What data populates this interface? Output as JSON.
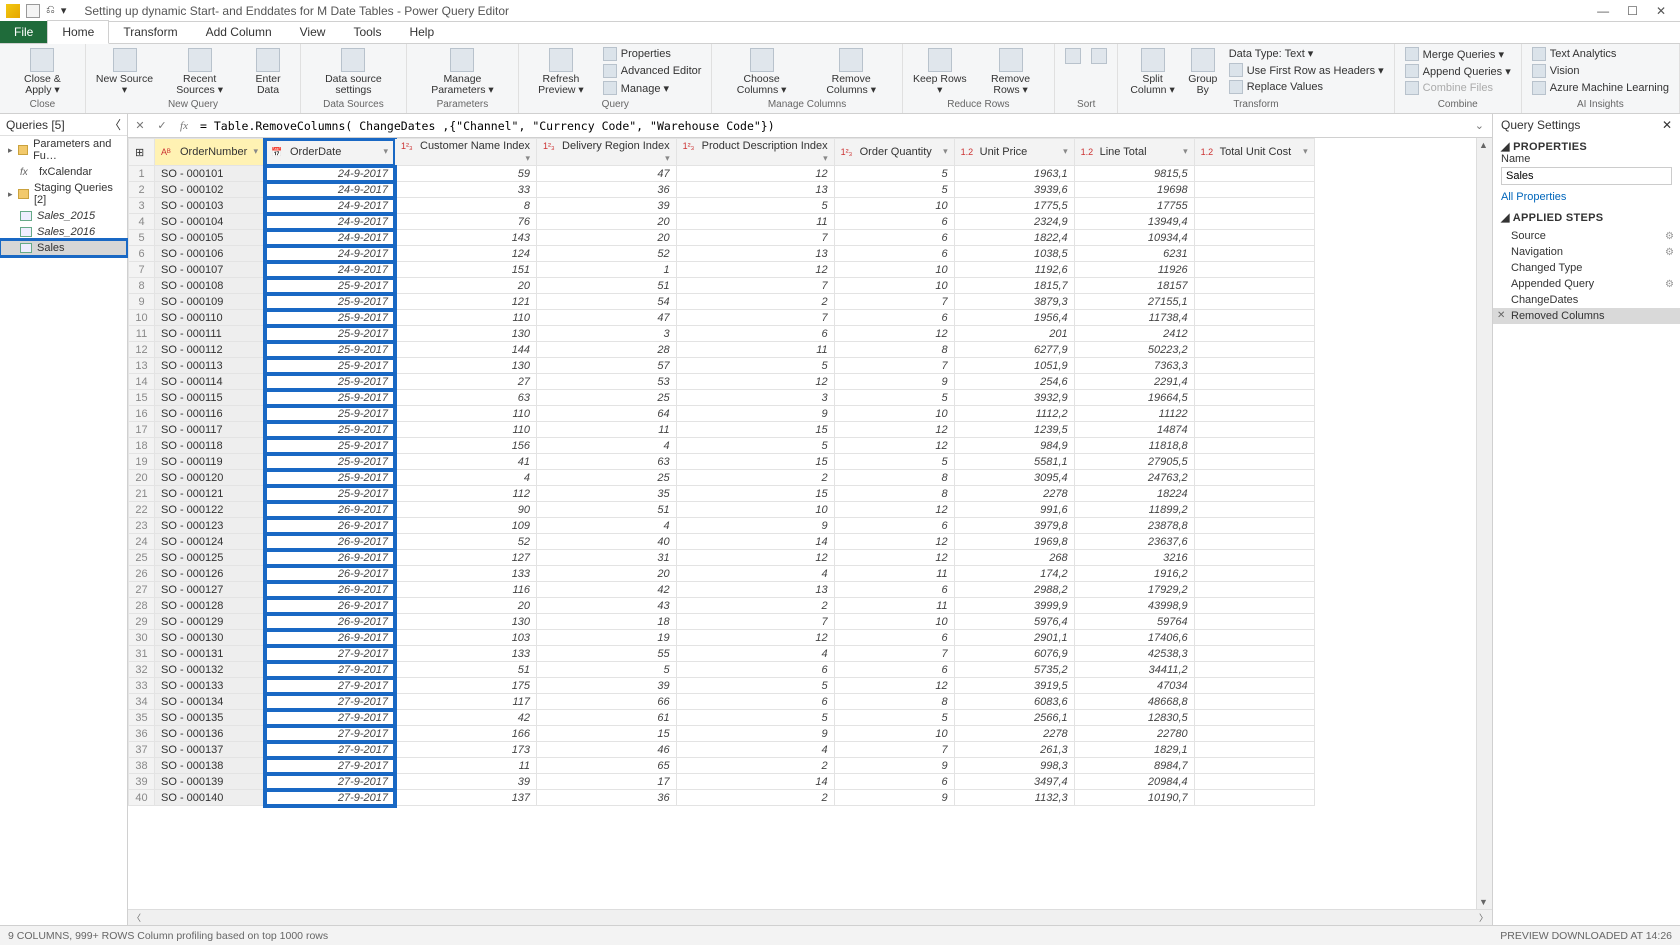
{
  "title": "Setting up dynamic Start- and Enddates for M Date Tables - Power Query Editor",
  "tabs": {
    "file": "File",
    "items": [
      "Home",
      "Transform",
      "Add Column",
      "View",
      "Tools",
      "Help"
    ],
    "active": "Home"
  },
  "ribbon": {
    "close": {
      "close_apply": "Close &\nApply ▾",
      "group": "Close"
    },
    "newquery": {
      "new_source": "New\nSource ▾",
      "recent": "Recent\nSources ▾",
      "enter": "Enter\nData",
      "group": "New Query"
    },
    "datasources": {
      "settings": "Data source\nsettings",
      "group": "Data Sources"
    },
    "parameters": {
      "manage": "Manage\nParameters ▾",
      "group": "Parameters"
    },
    "query": {
      "refresh": "Refresh\nPreview ▾",
      "properties": "Properties",
      "advanced": "Advanced Editor",
      "manage": "Manage ▾",
      "group": "Query"
    },
    "managecols": {
      "choose": "Choose\nColumns ▾",
      "remove": "Remove\nColumns ▾",
      "group": "Manage Columns"
    },
    "reducerows": {
      "keep": "Keep\nRows ▾",
      "remove": "Remove\nRows ▾",
      "group": "Reduce Rows"
    },
    "sort": {
      "group": "Sort"
    },
    "transform": {
      "split": "Split\nColumn ▾",
      "groupby": "Group\nBy",
      "datatype": "Data Type: Text ▾",
      "first": "Use First Row as Headers ▾",
      "replace": "Replace Values",
      "group": "Transform"
    },
    "combine": {
      "merge": "Merge Queries ▾",
      "append": "Append Queries ▾",
      "combine": "Combine Files",
      "group": "Combine"
    },
    "ai": {
      "text": "Text Analytics",
      "vision": "Vision",
      "ml": "Azure Machine Learning",
      "group": "AI Insights"
    }
  },
  "queries": {
    "header": "Queries [5]",
    "items": [
      {
        "kind": "fld",
        "label": "Parameters and Fu…"
      },
      {
        "kind": "fx",
        "label": "fxCalendar",
        "indent": 1
      },
      {
        "kind": "fld",
        "label": "Staging Queries [2]"
      },
      {
        "kind": "tbl",
        "label": "Sales_2015",
        "indent": 1,
        "italic": true
      },
      {
        "kind": "tbl",
        "label": "Sales_2016",
        "indent": 1,
        "italic": true
      },
      {
        "kind": "tbl",
        "label": "Sales",
        "indent": 1,
        "selected": true,
        "highlight": true
      }
    ]
  },
  "formula": "= Table.RemoveColumns( ChangeDates ,{\"Channel\", \"Currency Code\", \"Warehouse Code\"})",
  "columns": [
    {
      "name": "OrderNumber",
      "type": "Aᴮ",
      "align": "txt",
      "selected": true
    },
    {
      "name": "OrderDate",
      "type": "📅",
      "align": "num",
      "highlight": true
    },
    {
      "name": "Customer Name Index",
      "type": "1²₃",
      "align": "num"
    },
    {
      "name": "Delivery Region Index",
      "type": "1²₃",
      "align": "num"
    },
    {
      "name": "Product Description Index",
      "type": "1²₃",
      "align": "num"
    },
    {
      "name": "Order Quantity",
      "type": "1²₃",
      "align": "num"
    },
    {
      "name": "Unit Price",
      "type": "1.2",
      "align": "num"
    },
    {
      "name": "Line Total",
      "type": "1.2",
      "align": "num"
    },
    {
      "name": "Total Unit Cost",
      "type": "1.2",
      "align": "num"
    }
  ],
  "rows": [
    [
      "SO - 000101",
      "24-9-2017",
      "59",
      "47",
      "12",
      "5",
      "1963,1",
      "9815,5",
      ""
    ],
    [
      "SO - 000102",
      "24-9-2017",
      "33",
      "36",
      "13",
      "5",
      "3939,6",
      "19698",
      ""
    ],
    [
      "SO - 000103",
      "24-9-2017",
      "8",
      "39",
      "5",
      "10",
      "1775,5",
      "17755",
      ""
    ],
    [
      "SO - 000104",
      "24-9-2017",
      "76",
      "20",
      "11",
      "6",
      "2324,9",
      "13949,4",
      ""
    ],
    [
      "SO - 000105",
      "24-9-2017",
      "143",
      "20",
      "7",
      "6",
      "1822,4",
      "10934,4",
      ""
    ],
    [
      "SO - 000106",
      "24-9-2017",
      "124",
      "52",
      "13",
      "6",
      "1038,5",
      "6231",
      ""
    ],
    [
      "SO - 000107",
      "24-9-2017",
      "151",
      "1",
      "12",
      "10",
      "1192,6",
      "11926",
      ""
    ],
    [
      "SO - 000108",
      "25-9-2017",
      "20",
      "51",
      "7",
      "10",
      "1815,7",
      "18157",
      ""
    ],
    [
      "SO - 000109",
      "25-9-2017",
      "121",
      "54",
      "2",
      "7",
      "3879,3",
      "27155,1",
      ""
    ],
    [
      "SO - 000110",
      "25-9-2017",
      "110",
      "47",
      "7",
      "6",
      "1956,4",
      "11738,4",
      ""
    ],
    [
      "SO - 000111",
      "25-9-2017",
      "130",
      "3",
      "6",
      "12",
      "201",
      "2412",
      ""
    ],
    [
      "SO - 000112",
      "25-9-2017",
      "144",
      "28",
      "11",
      "8",
      "6277,9",
      "50223,2",
      ""
    ],
    [
      "SO - 000113",
      "25-9-2017",
      "130",
      "57",
      "5",
      "7",
      "1051,9",
      "7363,3",
      ""
    ],
    [
      "SO - 000114",
      "25-9-2017",
      "27",
      "53",
      "12",
      "9",
      "254,6",
      "2291,4",
      ""
    ],
    [
      "SO - 000115",
      "25-9-2017",
      "63",
      "25",
      "3",
      "5",
      "3932,9",
      "19664,5",
      ""
    ],
    [
      "SO - 000116",
      "25-9-2017",
      "110",
      "64",
      "9",
      "10",
      "1112,2",
      "11122",
      ""
    ],
    [
      "SO - 000117",
      "25-9-2017",
      "110",
      "11",
      "15",
      "12",
      "1239,5",
      "14874",
      ""
    ],
    [
      "SO - 000118",
      "25-9-2017",
      "156",
      "4",
      "5",
      "12",
      "984,9",
      "11818,8",
      ""
    ],
    [
      "SO - 000119",
      "25-9-2017",
      "41",
      "63",
      "15",
      "5",
      "5581,1",
      "27905,5",
      ""
    ],
    [
      "SO - 000120",
      "25-9-2017",
      "4",
      "25",
      "2",
      "8",
      "3095,4",
      "24763,2",
      ""
    ],
    [
      "SO - 000121",
      "25-9-2017",
      "112",
      "35",
      "15",
      "8",
      "2278",
      "18224",
      ""
    ],
    [
      "SO - 000122",
      "26-9-2017",
      "90",
      "51",
      "10",
      "12",
      "991,6",
      "11899,2",
      ""
    ],
    [
      "SO - 000123",
      "26-9-2017",
      "109",
      "4",
      "9",
      "6",
      "3979,8",
      "23878,8",
      ""
    ],
    [
      "SO - 000124",
      "26-9-2017",
      "52",
      "40",
      "14",
      "12",
      "1969,8",
      "23637,6",
      ""
    ],
    [
      "SO - 000125",
      "26-9-2017",
      "127",
      "31",
      "12",
      "12",
      "268",
      "3216",
      ""
    ],
    [
      "SO - 000126",
      "26-9-2017",
      "133",
      "20",
      "4",
      "11",
      "174,2",
      "1916,2",
      ""
    ],
    [
      "SO - 000127",
      "26-9-2017",
      "116",
      "42",
      "13",
      "6",
      "2988,2",
      "17929,2",
      ""
    ],
    [
      "SO - 000128",
      "26-9-2017",
      "20",
      "43",
      "2",
      "11",
      "3999,9",
      "43998,9",
      ""
    ],
    [
      "SO - 000129",
      "26-9-2017",
      "130",
      "18",
      "7",
      "10",
      "5976,4",
      "59764",
      ""
    ],
    [
      "SO - 000130",
      "26-9-2017",
      "103",
      "19",
      "12",
      "6",
      "2901,1",
      "17406,6",
      ""
    ],
    [
      "SO - 000131",
      "27-9-2017",
      "133",
      "55",
      "4",
      "7",
      "6076,9",
      "42538,3",
      ""
    ],
    [
      "SO - 000132",
      "27-9-2017",
      "51",
      "5",
      "6",
      "6",
      "5735,2",
      "34411,2",
      ""
    ],
    [
      "SO - 000133",
      "27-9-2017",
      "175",
      "39",
      "5",
      "12",
      "3919,5",
      "47034",
      ""
    ],
    [
      "SO - 000134",
      "27-9-2017",
      "117",
      "66",
      "6",
      "8",
      "6083,6",
      "48668,8",
      ""
    ],
    [
      "SO - 000135",
      "27-9-2017",
      "42",
      "61",
      "5",
      "5",
      "2566,1",
      "12830,5",
      ""
    ],
    [
      "SO - 000136",
      "27-9-2017",
      "166",
      "15",
      "9",
      "10",
      "2278",
      "22780",
      ""
    ],
    [
      "SO - 000137",
      "27-9-2017",
      "173",
      "46",
      "4",
      "7",
      "261,3",
      "1829,1",
      ""
    ],
    [
      "SO - 000138",
      "27-9-2017",
      "11",
      "65",
      "2",
      "9",
      "998,3",
      "8984,7",
      ""
    ],
    [
      "SO - 000139",
      "27-9-2017",
      "39",
      "17",
      "14",
      "6",
      "3497,4",
      "20984,4",
      ""
    ],
    [
      "SO - 000140",
      "27-9-2017",
      "137",
      "36",
      "2",
      "9",
      "1132,3",
      "10190,7",
      ""
    ]
  ],
  "settings": {
    "header": "Query Settings",
    "properties": "PROPERTIES",
    "name_label": "Name",
    "name_value": "Sales",
    "all_props": "All Properties",
    "applied": "APPLIED STEPS",
    "steps": [
      {
        "label": "Source",
        "gear": true
      },
      {
        "label": "Navigation",
        "gear": true
      },
      {
        "label": "Changed Type"
      },
      {
        "label": "Appended Query",
        "gear": true
      },
      {
        "label": "ChangeDates"
      },
      {
        "label": "Removed Columns",
        "selected": true
      }
    ]
  },
  "status": {
    "left": "9 COLUMNS, 999+ ROWS    Column profiling based on top 1000 rows",
    "right": "PREVIEW DOWNLOADED AT 14:26"
  }
}
